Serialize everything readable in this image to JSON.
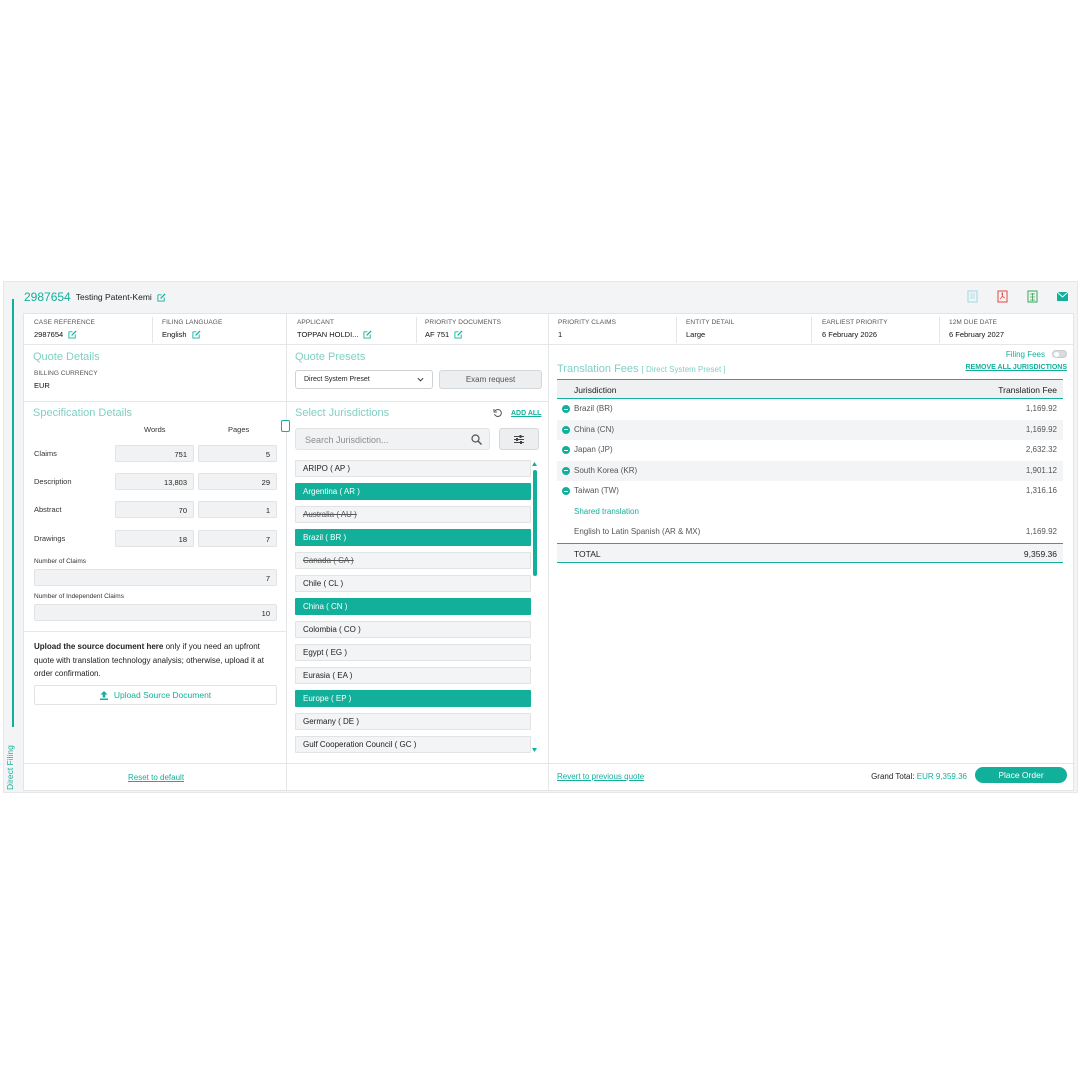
{
  "header": {
    "case_number": "2987654",
    "case_name": "Testing Patent-Kemi"
  },
  "side_tab": "Direct Filing",
  "meta": [
    {
      "label": "CASE REFERENCE",
      "value": "2987654",
      "editable": true
    },
    {
      "label": "FILING LANGUAGE",
      "value": "English",
      "editable": true
    },
    {
      "label": "APPLICANT",
      "value": "TOPPAN HOLDI...",
      "editable": true
    },
    {
      "label": "PRIORITY DOCUMENTS",
      "value": "AF 751",
      "editable": true
    },
    {
      "label": "PRIORITY CLAIMS",
      "value": "1",
      "editable": false
    },
    {
      "label": "ENTITY DETAIL",
      "value": "Large",
      "editable": false
    },
    {
      "label": "EARLIEST PRIORITY",
      "value": "6 February 2026",
      "editable": false
    },
    {
      "label": "12M DUE DATE",
      "value": "6 February 2027",
      "editable": false
    }
  ],
  "quote_details": {
    "title": "Quote Details",
    "billing_label": "BILLING CURRENCY",
    "billing_value": "EUR"
  },
  "spec": {
    "title": "Specification Details",
    "col_words": "Words",
    "col_pages": "Pages",
    "rows": [
      {
        "label": "Claims",
        "words": "751",
        "pages": "5"
      },
      {
        "label": "Description",
        "words": "13,803",
        "pages": "29"
      },
      {
        "label": "Abstract",
        "words": "70",
        "pages": "1"
      },
      {
        "label": "Drawings",
        "words": "18",
        "pages": "7"
      }
    ],
    "num_claims_label": "Number of Claims",
    "num_claims": "7",
    "num_indep_label": "Number of Independent Claims",
    "num_indep": "10"
  },
  "upload": {
    "bold": "Upload the source document here",
    "rest": " only if you need an upfront quote with translation technology analysis; otherwise, upload it at order confirmation.",
    "button": "Upload Source Document"
  },
  "reset_link": "Reset to default",
  "presets": {
    "title": "Quote Presets",
    "selected": "Direct System Preset",
    "exam_button": "Exam request"
  },
  "jurisdictions": {
    "title": "Select Jurisdictions",
    "add_all": "ADD ALL",
    "search_placeholder": "Search Jurisdiction...",
    "items": [
      {
        "label": "ARIPO ( AP )",
        "state": "normal"
      },
      {
        "label": "Argentina ( AR )",
        "state": "selected"
      },
      {
        "label": "Australia ( AU )",
        "state": "strike"
      },
      {
        "label": "Brazil ( BR )",
        "state": "selected"
      },
      {
        "label": "Canada ( CA )",
        "state": "strike"
      },
      {
        "label": "Chile ( CL )",
        "state": "normal"
      },
      {
        "label": "China ( CN )",
        "state": "selected"
      },
      {
        "label": "Colombia ( CO )",
        "state": "normal"
      },
      {
        "label": "Egypt ( EG )",
        "state": "normal"
      },
      {
        "label": "Eurasia ( EA )",
        "state": "normal"
      },
      {
        "label": "Europe ( EP )",
        "state": "selected"
      },
      {
        "label": "Germany ( DE )",
        "state": "normal"
      },
      {
        "label": "Gulf Cooperation Council ( GC )",
        "state": "normal"
      }
    ]
  },
  "fees": {
    "title": "Translation Fees",
    "preset": "[ Direct System Preset ]",
    "filing_fees_label": "Filing Fees",
    "remove_all": "REMOVE ALL JURISDICTIONS",
    "col_jurisdiction": "Jurisdiction",
    "col_fee": "Translation Fee",
    "rows": [
      {
        "name": "Brazil (BR)",
        "fee": "1,169.92"
      },
      {
        "name": "China (CN)",
        "fee": "1,169.92"
      },
      {
        "name": "Japan (JP)",
        "fee": "2,632.32"
      },
      {
        "name": "South Korea (KR)",
        "fee": "1,901.12"
      },
      {
        "name": "Taiwan (TW)",
        "fee": "1,316.16"
      }
    ],
    "shared_label": "Shared translation",
    "shared_row": {
      "name": "English to Latin Spanish (AR & MX)",
      "fee": "1,169.92"
    },
    "total_label": "TOTAL",
    "total_value": "9,359.36"
  },
  "footer": {
    "revert": "Revert to previous quote",
    "grand_total_label": "Grand Total:",
    "grand_total_value": "EUR 9,359.36",
    "place_order": "Place Order"
  },
  "colors": {
    "accent": "#12b09a",
    "selected_row": "#12b09a",
    "pdf_icon": "#e04848",
    "excel_icon": "#3aa65a"
  }
}
